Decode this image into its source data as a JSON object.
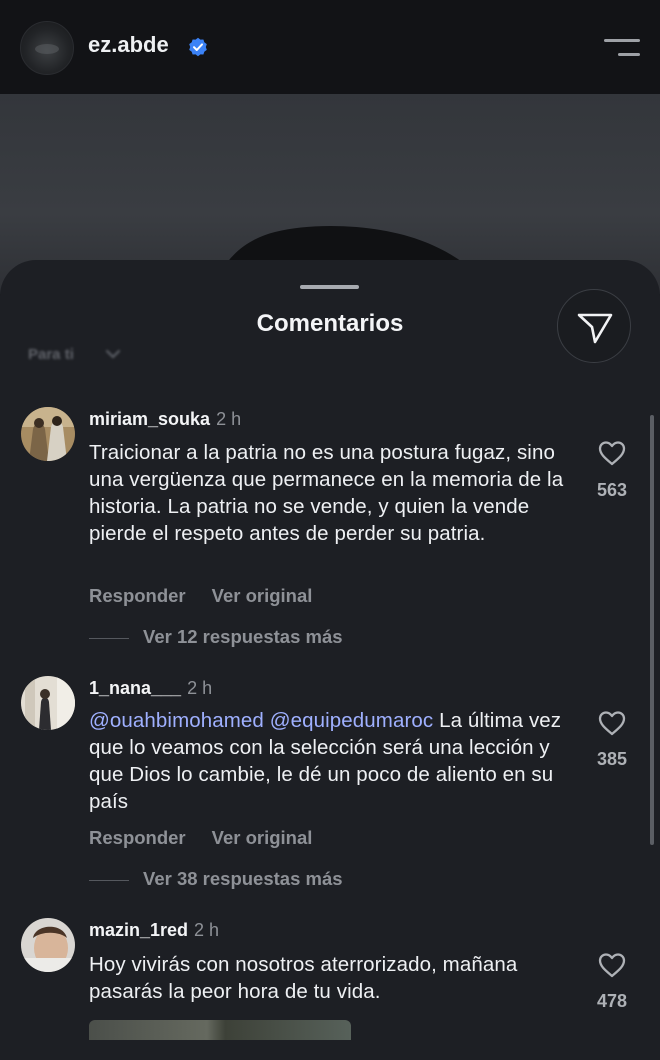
{
  "header": {
    "username": "ez.abde",
    "verified": true
  },
  "sheet": {
    "title": "Comentarios",
    "filter_label": "Para ti"
  },
  "comments": [
    {
      "user": "miriam_souka",
      "time": "2 h",
      "text": "Traicionar a la patria no es una postura fugaz, sino una vergüenza que permanece en la memoria de la historia. La patria no se vende, y quien la vende pierde el respeto antes de perder su patria.",
      "likes": "563",
      "reply_label": "Responder",
      "original_label": "Ver original",
      "more_replies": "Ver 12 respuestas más"
    },
    {
      "user": "1_nana___",
      "time": "2 h",
      "mentions": [
        "@ouahbimohamed",
        "@equipedumaroc"
      ],
      "text": "La última vez que lo veamos con la selección será una lección y que Dios lo cambie, le dé un poco de aliento en su país",
      "likes": "385",
      "reply_label": "Responder",
      "original_label": "Ver original",
      "more_replies": "Ver 38 respuestas más"
    },
    {
      "user": "mazin_1red",
      "time": "2 h",
      "text": "Hoy vivirás con nosotros aterrorizado, mañana pasarás la peor hora de tu vida.",
      "likes": "478"
    }
  ],
  "colors": {
    "sheet_bg": "#1d1f24",
    "mention": "#9fb0ff",
    "muted": "#8e9197",
    "verified": "#3b82f6"
  }
}
